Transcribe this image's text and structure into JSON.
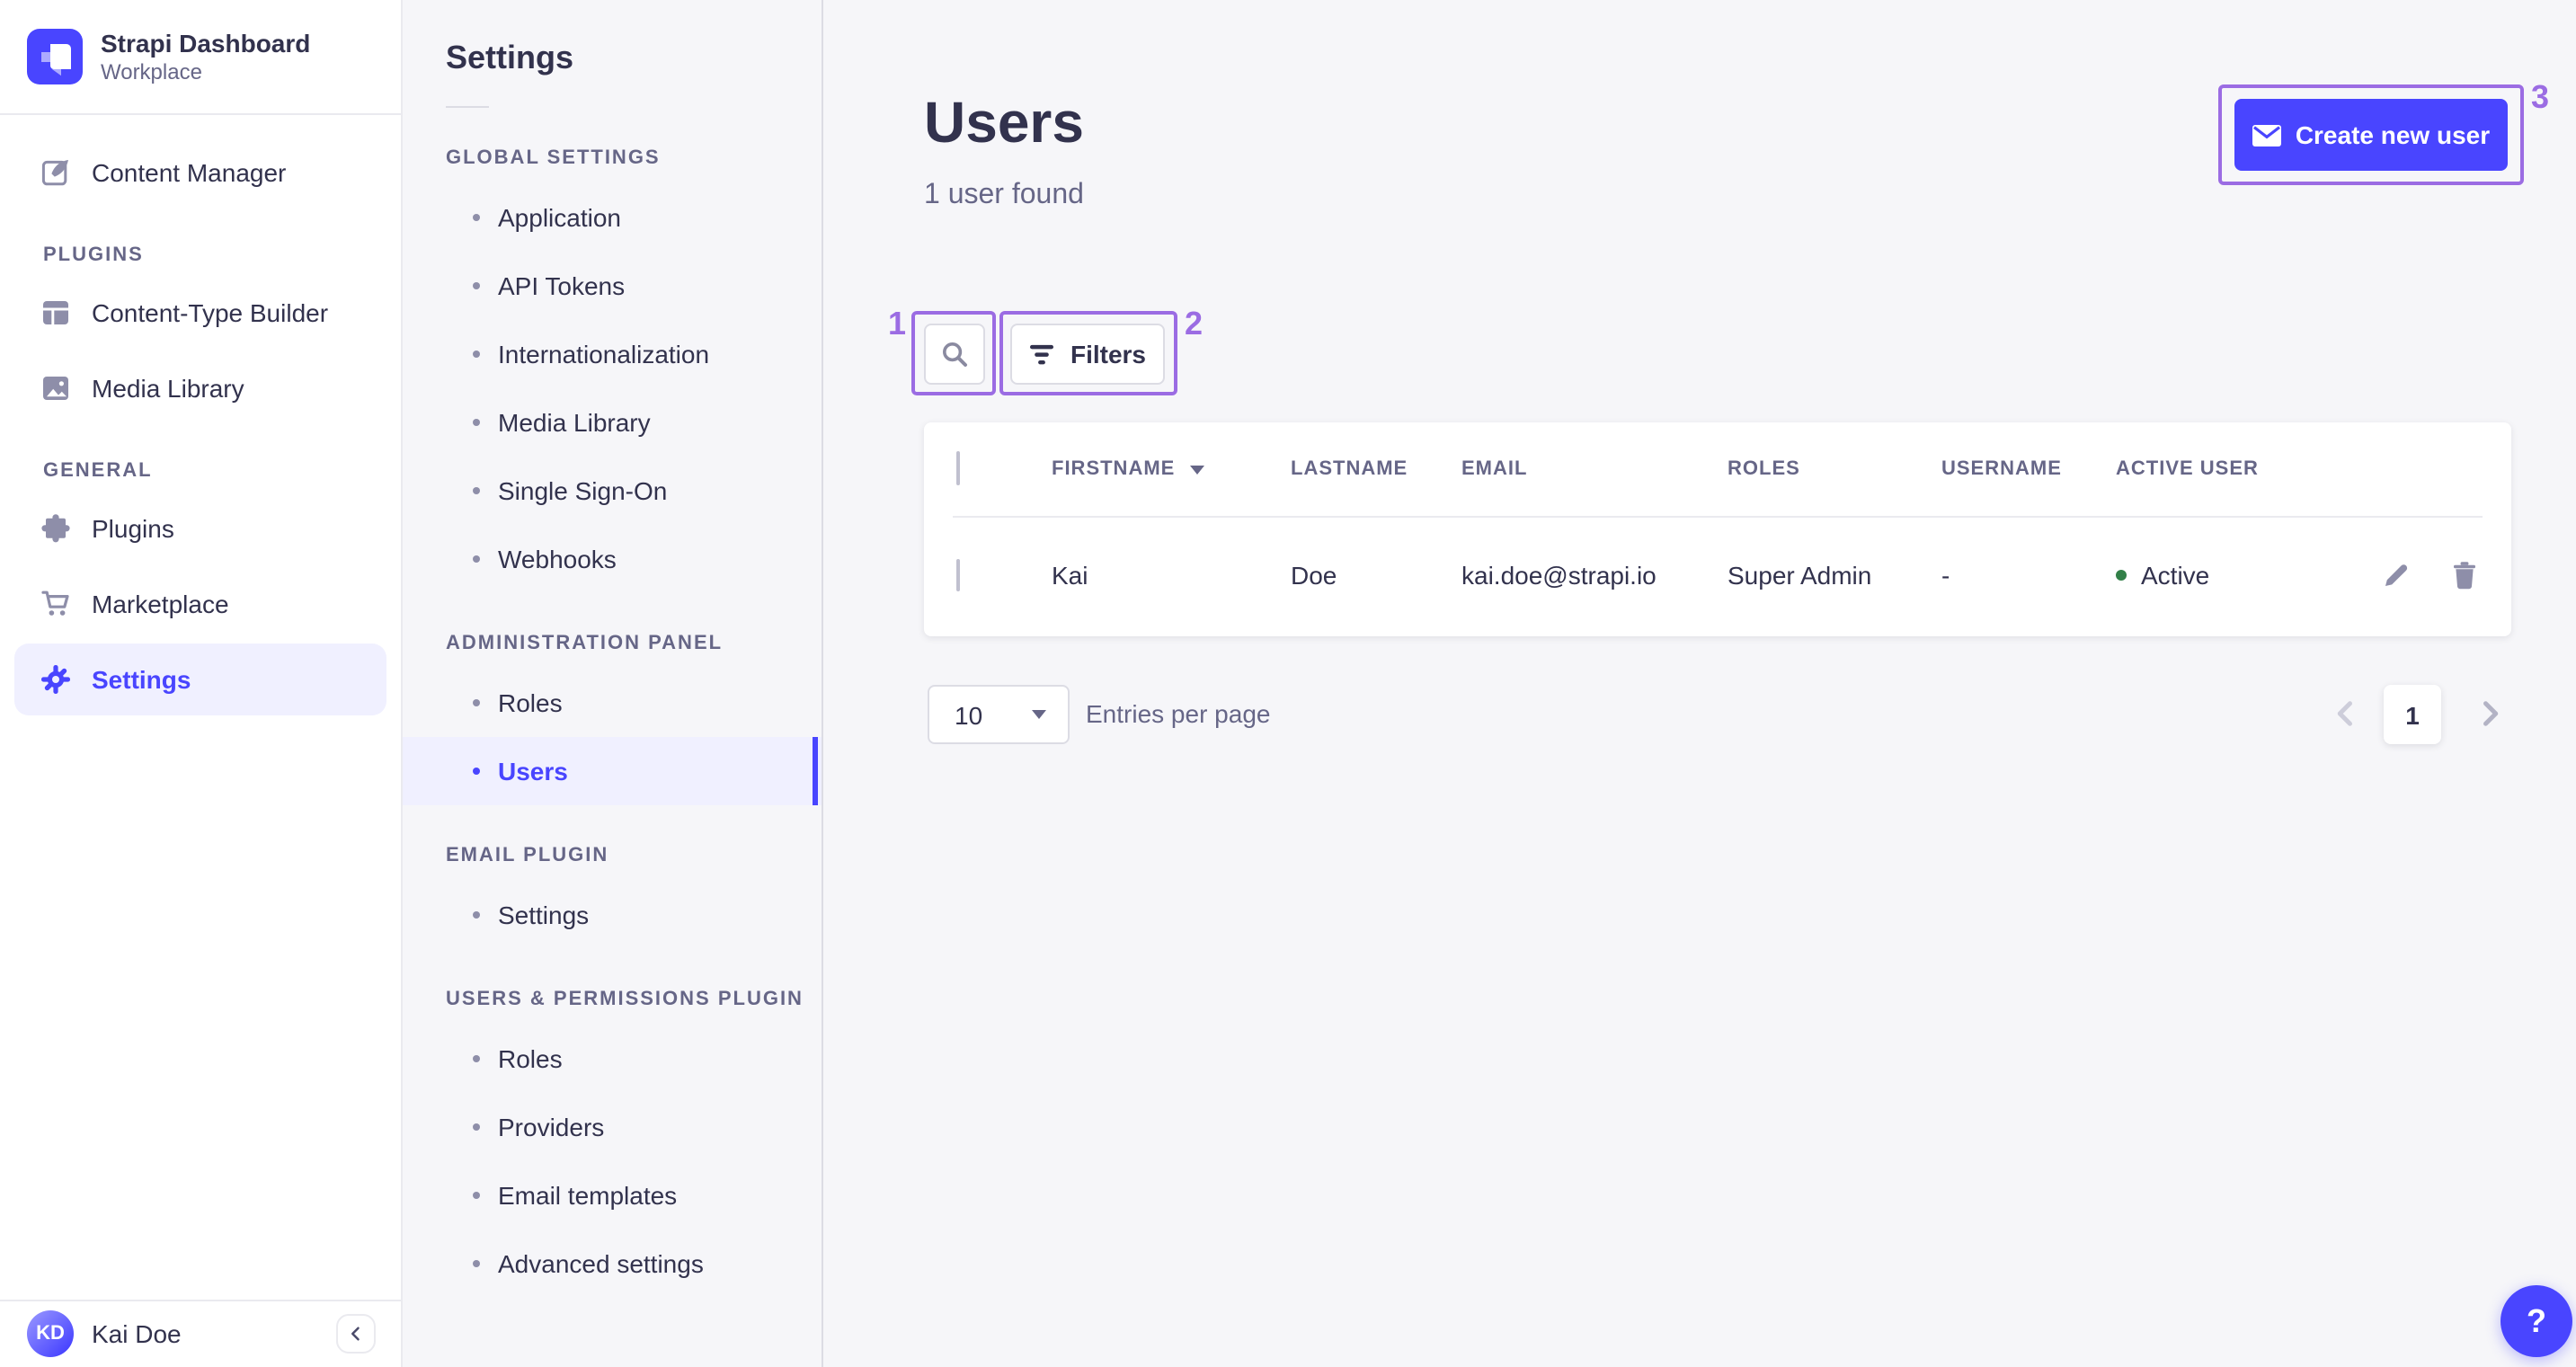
{
  "brand": {
    "name": "Strapi Dashboard",
    "workspace": "Workplace"
  },
  "nav": {
    "content_manager": "Content Manager",
    "sections": [
      {
        "label": "PLUGINS",
        "items": [
          {
            "label": "Content-Type Builder",
            "icon": "content-type-builder-icon"
          },
          {
            "label": "Media Library",
            "icon": "media-library-icon"
          }
        ]
      },
      {
        "label": "GENERAL",
        "items": [
          {
            "label": "Plugins",
            "icon": "plugins-icon"
          },
          {
            "label": "Marketplace",
            "icon": "marketplace-icon"
          },
          {
            "label": "Settings",
            "icon": "settings-icon",
            "active": true
          }
        ]
      }
    ],
    "user": {
      "initials": "KD",
      "name": "Kai Doe"
    }
  },
  "subnav": {
    "title": "Settings",
    "sections": [
      {
        "label": "GLOBAL SETTINGS",
        "items": [
          "Application",
          "API Tokens",
          "Internationalization",
          "Media Library",
          "Single Sign-On",
          "Webhooks"
        ]
      },
      {
        "label": "ADMINISTRATION PANEL",
        "items": [
          "Roles",
          "Users"
        ],
        "active_item": "Users"
      },
      {
        "label": "EMAIL PLUGIN",
        "items": [
          "Settings"
        ]
      },
      {
        "label": "USERS & PERMISSIONS PLUGIN",
        "items": [
          "Roles",
          "Providers",
          "Email templates",
          "Advanced settings"
        ]
      }
    ]
  },
  "main": {
    "title": "Users",
    "subtitle": "1 user found",
    "create_button": "Create new user",
    "filters_button": "Filters",
    "table": {
      "headers": [
        "FIRSTNAME",
        "LASTNAME",
        "EMAIL",
        "ROLES",
        "USERNAME",
        "ACTIVE USER"
      ],
      "rows": [
        {
          "firstname": "Kai",
          "lastname": "Doe",
          "email": "kai.doe@strapi.io",
          "roles": "Super Admin",
          "username": "-",
          "status": "Active"
        }
      ]
    },
    "pagination": {
      "page_size": "10",
      "entries_label": "Entries per page",
      "page": "1"
    },
    "help_label": "?"
  },
  "annotations": [
    {
      "n": "1"
    },
    {
      "n": "2"
    },
    {
      "n": "3"
    }
  ],
  "colors": {
    "primary": "#4945ff",
    "primary_bg": "#f0f0ff",
    "annotation": "#9b6ce3",
    "success": "#328048"
  }
}
